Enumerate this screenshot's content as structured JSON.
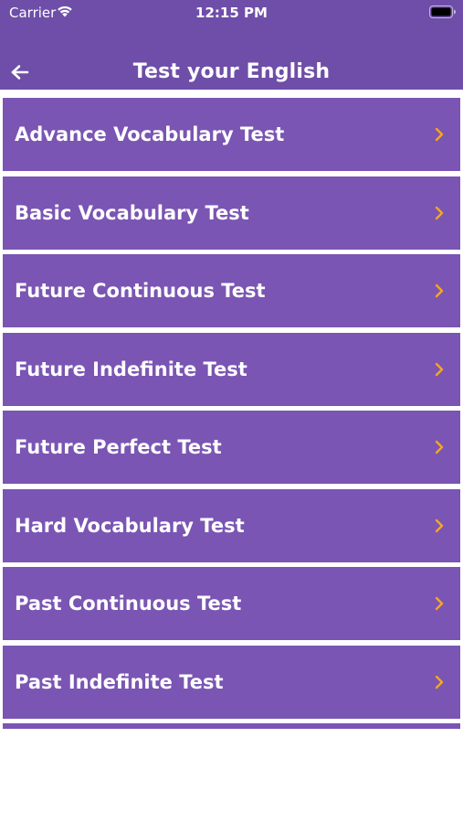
{
  "status_bar": {
    "carrier": "Carrier",
    "time": "12:15 PM"
  },
  "nav": {
    "title": "Test your English",
    "back_icon": "arrow-left-icon"
  },
  "colors": {
    "nav_background": "#6e4ea8",
    "row_background": "#7a55b3",
    "chevron": "#f5a623",
    "text": "#ffffff"
  },
  "tests": [
    {
      "label": "Advance Vocabulary Test"
    },
    {
      "label": "Basic Vocabulary Test"
    },
    {
      "label": "Future Continuous Test"
    },
    {
      "label": "Future Indefinite Test"
    },
    {
      "label": "Future Perfect Test"
    },
    {
      "label": "Hard Vocabulary Test"
    },
    {
      "label": "Past Continuous Test"
    },
    {
      "label": "Past Indefinite Test"
    }
  ]
}
